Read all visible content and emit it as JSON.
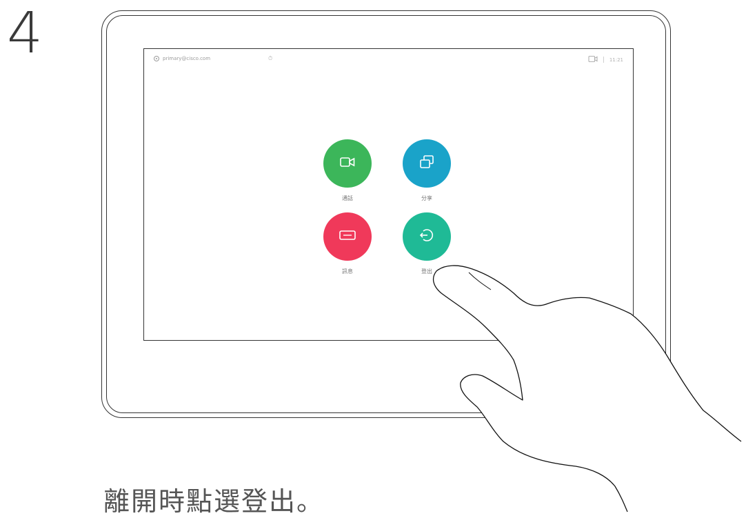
{
  "step": {
    "number": "4"
  },
  "screen": {
    "status": {
      "sip_address": "primary@cisco.com",
      "dnd_glyph": "⏱",
      "camera_icon": "camera-icon",
      "time": "11:21"
    },
    "tiles": [
      {
        "id": "call",
        "label": "通話",
        "color": "#3cb65a",
        "icon": "video-camera-icon"
      },
      {
        "id": "share",
        "label": "分享",
        "color": "#1aa3c9",
        "icon": "share-screen-icon"
      },
      {
        "id": "messages",
        "label": "訊息",
        "color": "#f0395a",
        "icon": "message-icon"
      },
      {
        "id": "signout",
        "label": "登出",
        "color": "#1fba96",
        "icon": "sign-out-icon"
      }
    ]
  },
  "caption": {
    "text": "離開時點選登出。"
  }
}
